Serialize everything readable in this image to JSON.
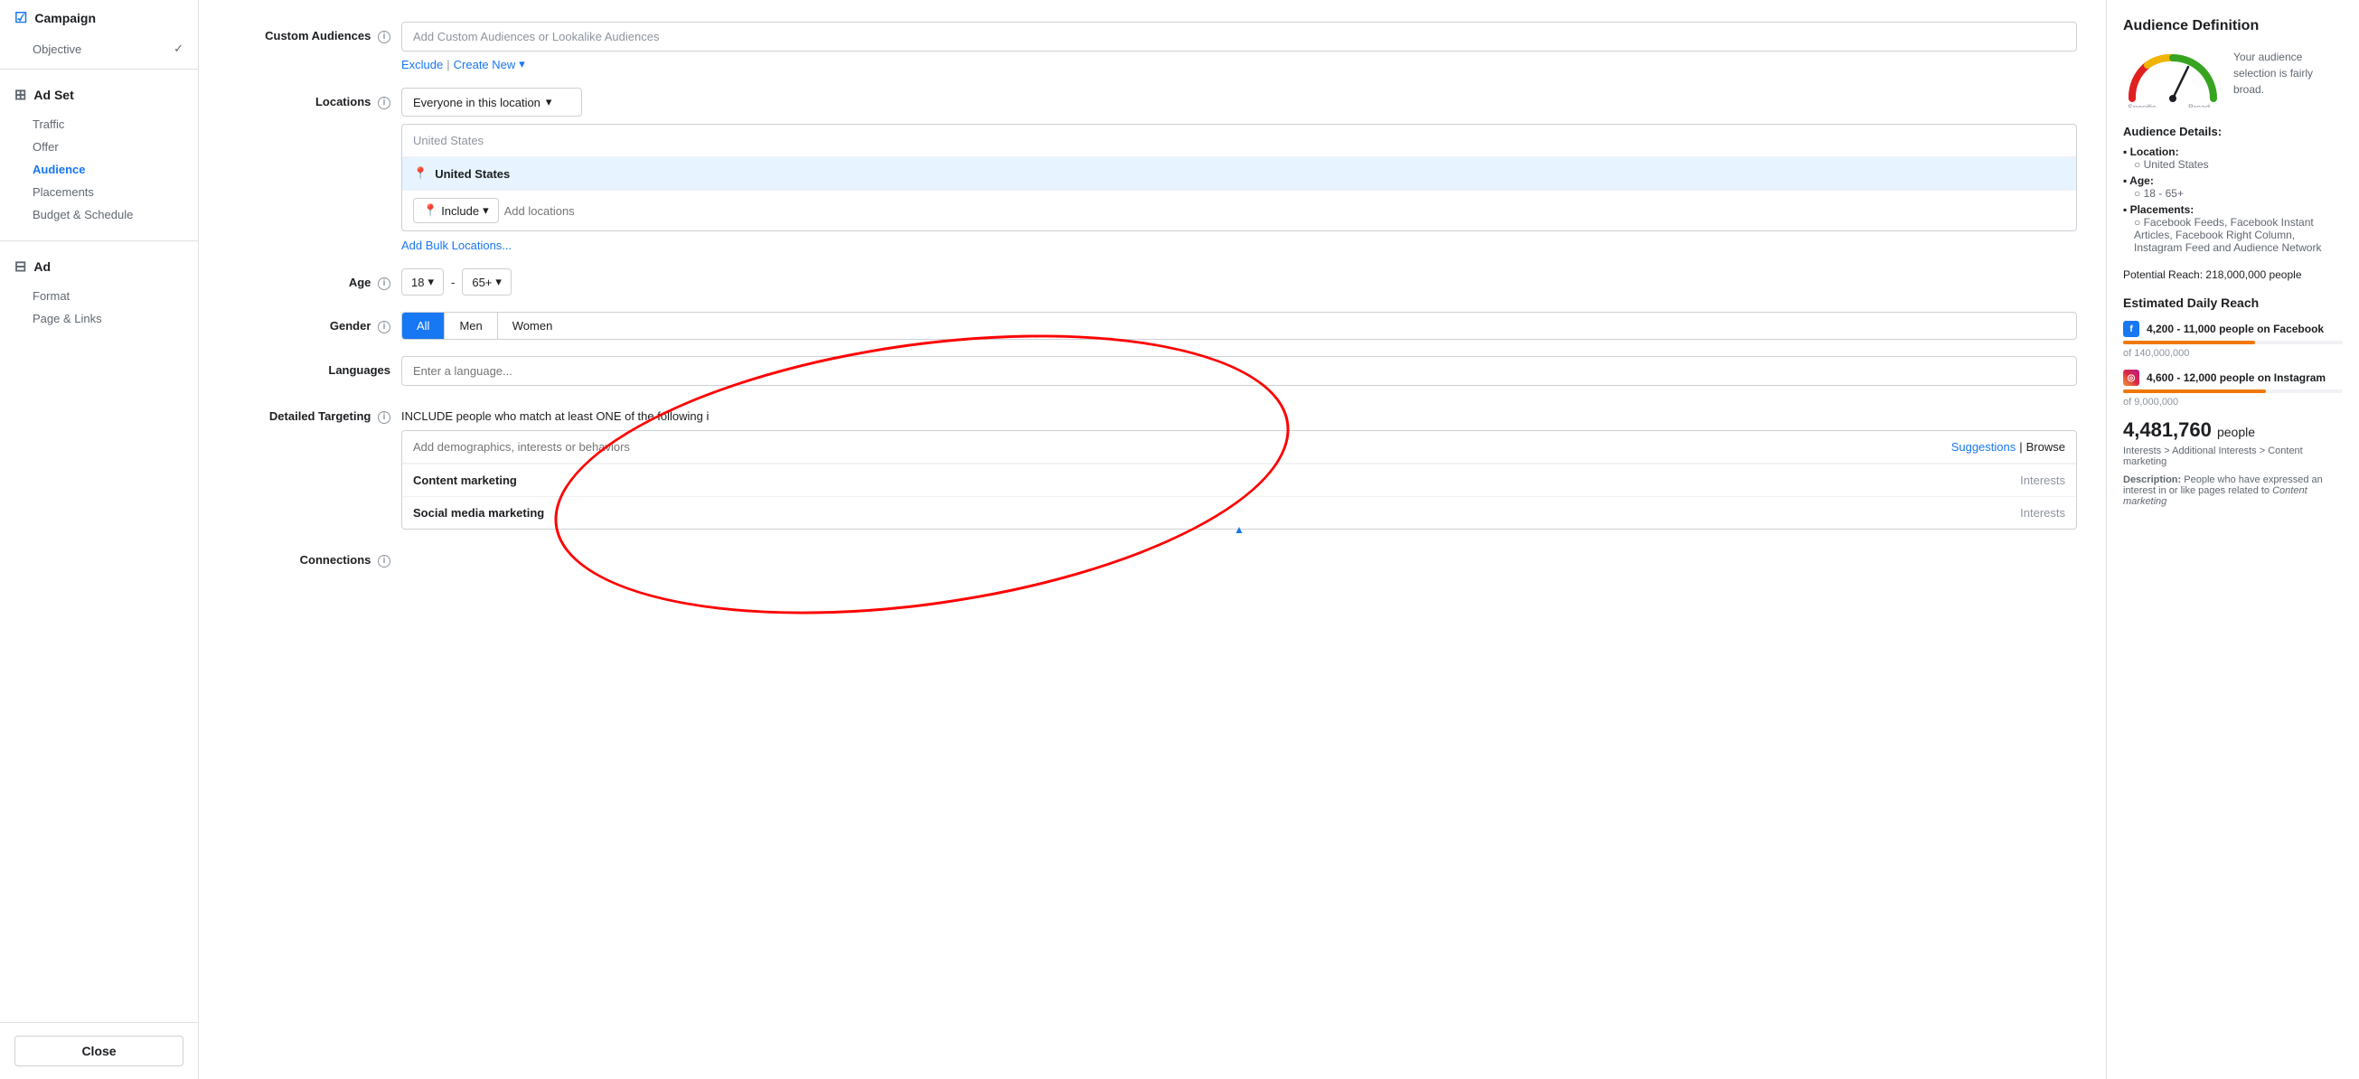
{
  "sidebar": {
    "campaign_label": "Campaign",
    "objective_label": "Objective",
    "adset_label": "Ad Set",
    "adset_items": [
      {
        "label": "Traffic",
        "active": false
      },
      {
        "label": "Offer",
        "active": false
      },
      {
        "label": "Audience",
        "active": true
      },
      {
        "label": "Placements",
        "active": false
      },
      {
        "label": "Budget & Schedule",
        "active": false
      }
    ],
    "ad_label": "Ad",
    "ad_items": [
      {
        "label": "Format",
        "active": false
      },
      {
        "label": "Page & Links",
        "active": false
      }
    ],
    "close_label": "Close"
  },
  "form": {
    "custom_audiences_label": "Custom Audiences",
    "custom_audiences_placeholder": "Add Custom Audiences or Lookalike Audiences",
    "exclude_label": "Exclude",
    "create_new_label": "Create New",
    "locations_label": "Locations",
    "location_dropdown": "Everyone in this location",
    "location_search_placeholder": "United States",
    "location_entry": "United States",
    "include_label": "Include",
    "add_locations_placeholder": "Add locations",
    "bulk_link": "Add Bulk Locations...",
    "age_label": "Age",
    "age_from": "18",
    "age_to": "65+",
    "gender_label": "Gender",
    "gender_options": [
      "All",
      "Men",
      "Women"
    ],
    "gender_active": "All",
    "languages_label": "Languages",
    "languages_placeholder": "Enter a language...",
    "detailed_targeting_label": "Detailed Targeting",
    "targeting_description": "INCLUDE people who match at least ONE of the following",
    "targeting_placeholder": "Add demographics, interests or behaviors",
    "suggestions_label": "Suggestions",
    "browse_label": "Browse",
    "targeting_rows": [
      {
        "name": "Content marketing",
        "type": "Interests"
      },
      {
        "name": "Social media marketing",
        "type": "Interests"
      }
    ],
    "connections_label": "Connections"
  },
  "audience_panel": {
    "title": "Audience Definition",
    "gauge_text": "Your audience selection is fairly broad.",
    "gauge_specific": "Specific",
    "gauge_broad": "Broad",
    "details_title": "Audience Details:",
    "details": [
      {
        "key": "Location:",
        "sub": [
          "United States"
        ]
      },
      {
        "key": "Age:",
        "sub": [
          "18 - 65+"
        ]
      },
      {
        "key": "Placements:",
        "sub": [
          "Facebook Feeds, Facebook Instant Articles, Facebook Right Column, Instagram Feed and Audience Network"
        ]
      }
    ],
    "potential_reach": "Potential Reach: 218,000,000 people",
    "est_daily_title": "Estimated Daily Reach",
    "fb_reach": "4,200 - 11,000 people on Facebook",
    "ig_reach": "4,600 - 12,000 people on Instagram",
    "fb_of": "of 140,000,000",
    "ig_of": "of 9,000,000",
    "big_number": "4,481,760 people",
    "interest_path": "Interests > Additional Interests > Content marketing",
    "description_label": "Description:",
    "description_text": "People who have expressed an interest in or like pages related to Content marketing"
  }
}
